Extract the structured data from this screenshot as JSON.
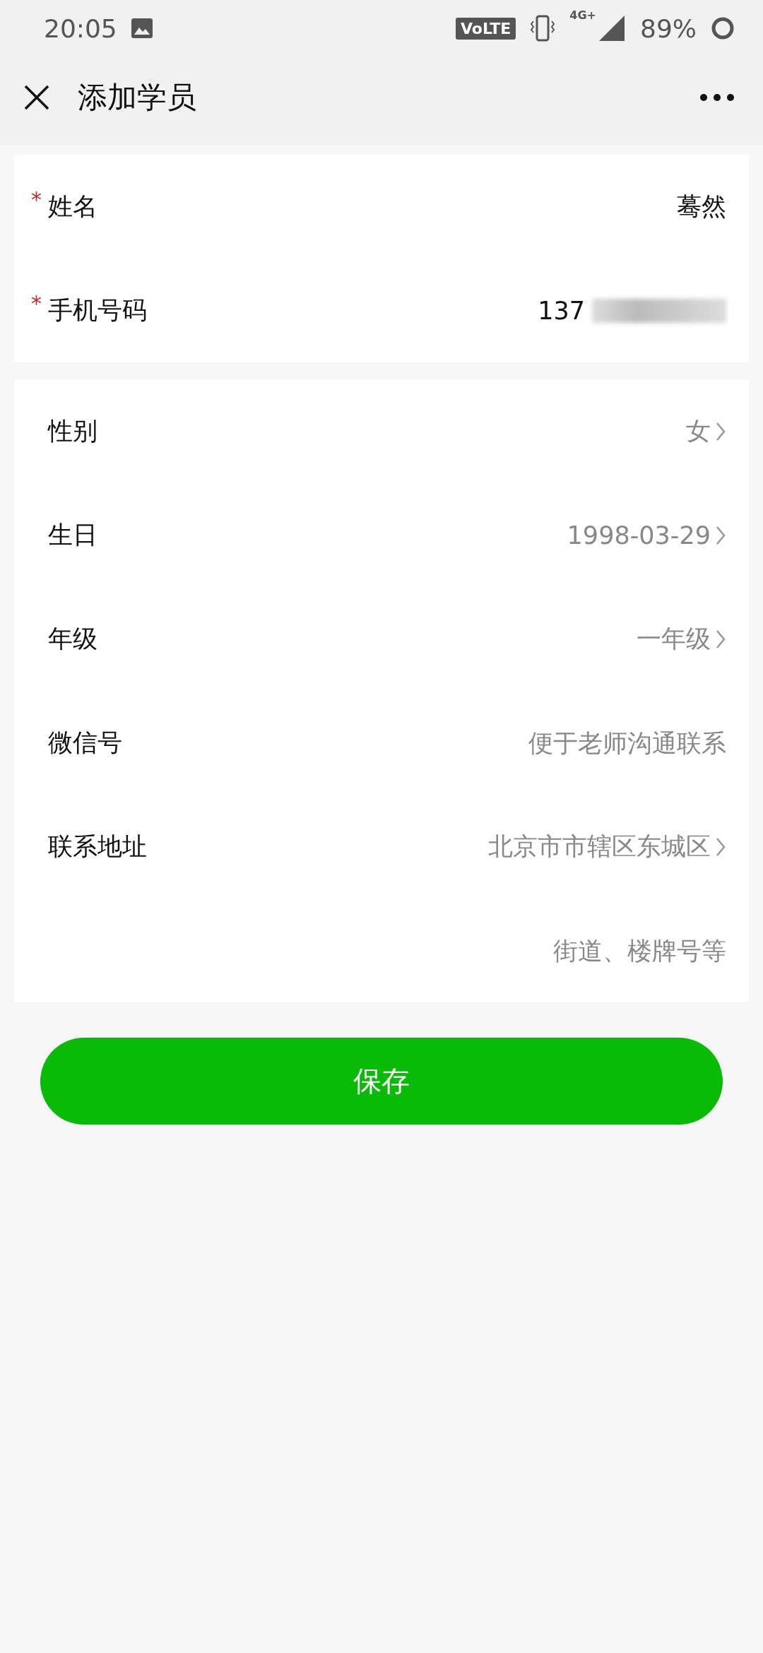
{
  "status_bar": {
    "time": "20:05",
    "volte": "VoLTE",
    "network": "4G+",
    "battery": "89%"
  },
  "nav": {
    "title": "添加学员"
  },
  "sections": [
    {
      "rows": [
        {
          "kind": "input",
          "required_mark": "*",
          "label": "姓名",
          "value": "蓦然"
        },
        {
          "kind": "input",
          "required_mark": "*",
          "label": "手机号码",
          "value": "137",
          "redacted": true
        }
      ]
    },
    {
      "rows": [
        {
          "kind": "picker",
          "label": "性别",
          "value": "女"
        },
        {
          "kind": "picker",
          "label": "生日",
          "value": "1998-03-29"
        },
        {
          "kind": "picker",
          "label": "年级",
          "value": "一年级"
        },
        {
          "kind": "input",
          "label": "微信号",
          "placeholder": "便于老师沟通联系"
        },
        {
          "kind": "picker",
          "label": "联系地址",
          "value": "北京市市辖区东城区"
        },
        {
          "kind": "input",
          "placeholder": "街道、楼牌号等"
        }
      ]
    }
  ],
  "save_button": "保存"
}
